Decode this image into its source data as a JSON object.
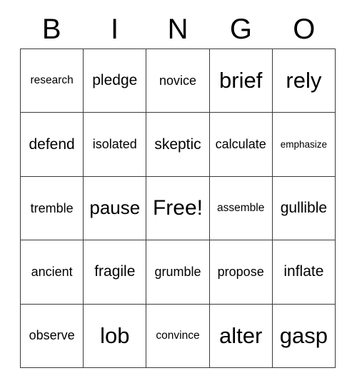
{
  "card": {
    "title": "BINGO",
    "header_letters": [
      "B",
      "I",
      "N",
      "G",
      "O"
    ],
    "free_space_label": "Free!",
    "grid_size": "5x5",
    "border_color": "#3a3a3a",
    "text_color": "#000000",
    "background_color": "#ffffff",
    "rows": [
      [
        {
          "word": "research",
          "size": "sz-s"
        },
        {
          "word": "pledge",
          "size": "sz-l"
        },
        {
          "word": "novice",
          "size": "sz-m"
        },
        {
          "word": "brief",
          "size": "sz-xxl"
        },
        {
          "word": "rely",
          "size": "sz-xxl"
        }
      ],
      [
        {
          "word": "defend",
          "size": "sz-l"
        },
        {
          "word": "isolated",
          "size": "sz-m"
        },
        {
          "word": "skeptic",
          "size": "sz-l"
        },
        {
          "word": "calculate",
          "size": "sz-m"
        },
        {
          "word": "emphasize",
          "size": "sz-xs"
        }
      ],
      [
        {
          "word": "tremble",
          "size": "sz-m"
        },
        {
          "word": "pause",
          "size": "sz-xl"
        },
        {
          "word": "Free!",
          "size": "sz-free"
        },
        {
          "word": "assemble",
          "size": "sz-s"
        },
        {
          "word": "gullible",
          "size": "sz-l"
        }
      ],
      [
        {
          "word": "ancient",
          "size": "sz-m"
        },
        {
          "word": "fragile",
          "size": "sz-l"
        },
        {
          "word": "grumble",
          "size": "sz-m"
        },
        {
          "word": "propose",
          "size": "sz-m"
        },
        {
          "word": "inflate",
          "size": "sz-l"
        }
      ],
      [
        {
          "word": "observe",
          "size": "sz-m"
        },
        {
          "word": "lob",
          "size": "sz-xxl"
        },
        {
          "word": "convince",
          "size": "sz-s"
        },
        {
          "word": "alter",
          "size": "sz-xxl"
        },
        {
          "word": "gasp",
          "size": "sz-xxl"
        }
      ]
    ]
  }
}
